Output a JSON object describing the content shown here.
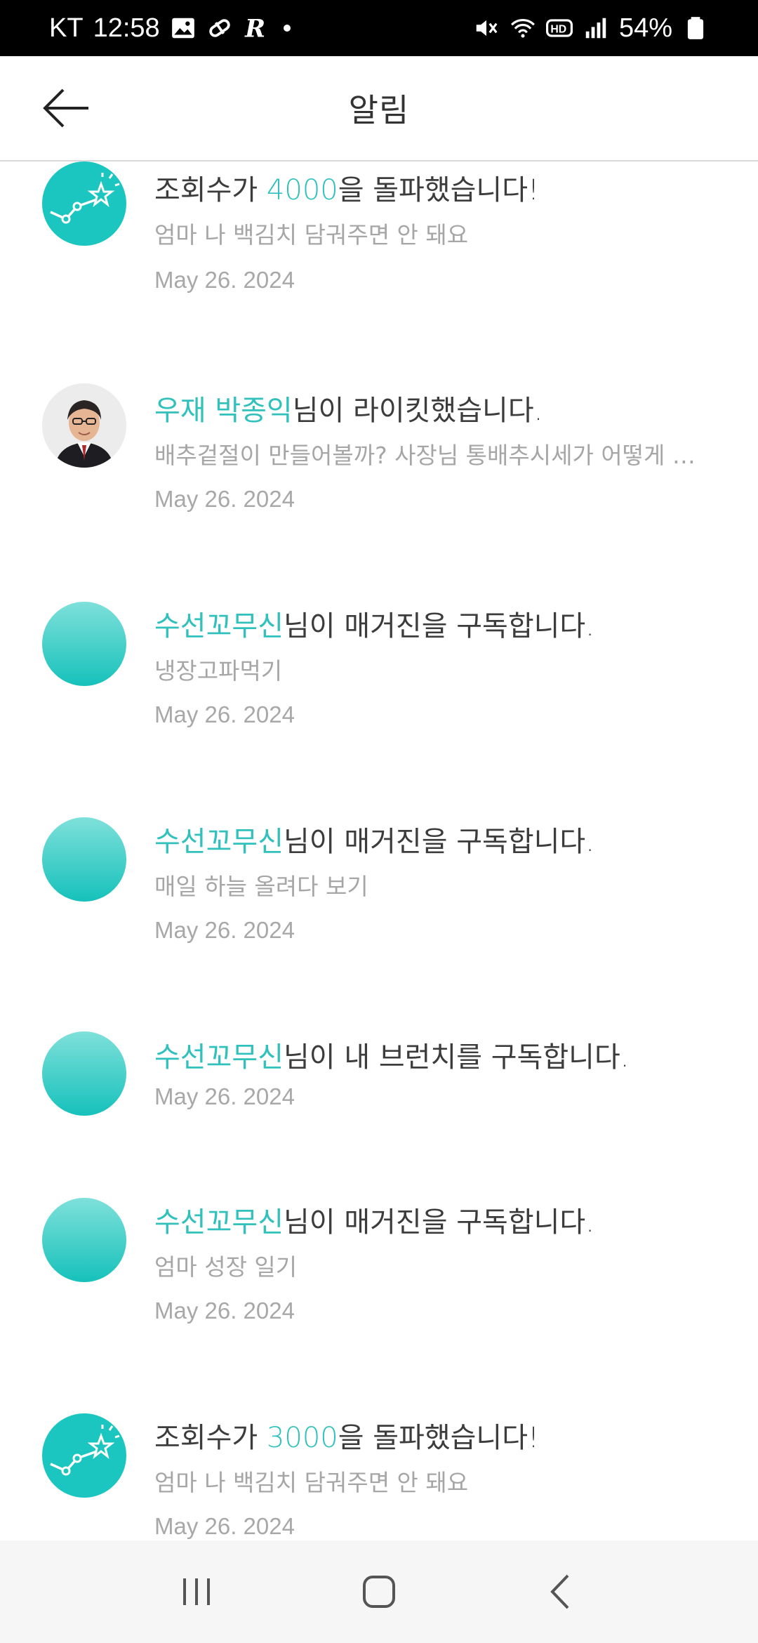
{
  "status_bar": {
    "carrier": "KT",
    "time": "12:58",
    "battery": "54%",
    "icons": [
      "image-icon",
      "pill-icon",
      "r-app-icon",
      "dot-icon",
      "mute-icon",
      "wifi-icon",
      "hd-icon",
      "signal-icon",
      "battery-icon"
    ]
  },
  "header": {
    "title": "알림",
    "back_icon": "arrow-left-icon"
  },
  "notifications": [
    {
      "avatar": "chart-star-icon",
      "title_highlight_prefix": "",
      "title_pre": "조회수가 ",
      "title_highlight": "4000",
      "title_post": "을 돌파했습니다!",
      "subtitle": "엄마 나 백김치 담궈주면 안 돼요",
      "date": "May 26. 2024"
    },
    {
      "avatar": "user-photo",
      "title_highlight": "우재 박종익",
      "title_post": "님이 라이킷했습니다.",
      "subtitle": "배추겉절이 만들어볼까? 사장님 통배추시세가 어떻게 …",
      "date": "May 26. 2024"
    },
    {
      "avatar": "gradient-avatar",
      "title_highlight": "수선꼬무신",
      "title_post": "님이 매거진을 구독합니다.",
      "subtitle": "냉장고파먹기",
      "date": "May 26. 2024"
    },
    {
      "avatar": "gradient-avatar",
      "title_highlight": "수선꼬무신",
      "title_post": "님이 매거진을 구독합니다.",
      "subtitle": "매일 하늘 올려다 보기",
      "date": "May 26. 2024"
    },
    {
      "avatar": "gradient-avatar",
      "title_highlight": "수선꼬무신",
      "title_post": "님이 내 브런치를 구독합니다.",
      "date": "May 26. 2024"
    },
    {
      "avatar": "gradient-avatar",
      "title_highlight": "수선꼬무신",
      "title_post": "님이 매거진을 구독합니다.",
      "subtitle": "엄마 성장 일기",
      "date": "May 26. 2024"
    },
    {
      "avatar": "chart-star-icon",
      "title_pre": "조회수가 ",
      "title_highlight": "3000",
      "title_post": "을 돌파했습니다!",
      "subtitle": "엄마 나 백김치 담궈주면 안 돼요",
      "date": "May 26. 2024"
    }
  ],
  "nav_bar": {
    "buttons": [
      "recent-apps-icon",
      "home-icon",
      "back-icon"
    ]
  },
  "colors": {
    "accent": "#30c1bd",
    "title_text": "#3c3c3c",
    "secondary_text": "#a6a6a6"
  }
}
